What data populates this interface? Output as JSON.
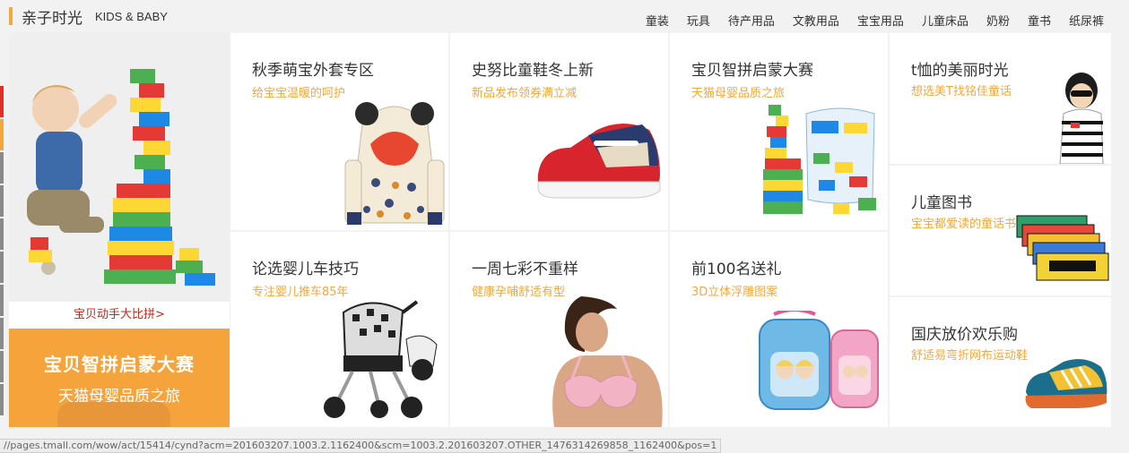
{
  "header": {
    "title": "亲子时光",
    "subtitle": "KIDS & BABY",
    "nav": [
      "童装",
      "玩具",
      "待产用品",
      "文教用品",
      "宝宝用品",
      "儿童床品",
      "奶粉",
      "童书",
      "纸尿裤"
    ]
  },
  "banner": {
    "link_label": "宝贝动手大比拼>",
    "promo_title": "宝贝智拼启蒙大赛",
    "promo_subtitle": "天猫母婴品质之旅"
  },
  "tiles": [
    {
      "title": "秋季萌宝外套专区",
      "subtitle": "给宝宝温暖的呵护",
      "icon": "kids-jacket-image"
    },
    {
      "title": "史努比童鞋冬上新",
      "subtitle": "新品发布领券满立减",
      "icon": "kids-sneaker-image"
    },
    {
      "title": "宝贝智拼启蒙大赛",
      "subtitle": "天猫母婴品质之旅",
      "icon": "building-blocks-image"
    },
    {
      "title": "论选婴儿车技巧",
      "subtitle": "专注婴儿推车85年",
      "icon": "baby-stroller-image"
    },
    {
      "title": "一周七彩不重样",
      "subtitle": "健康孕哺舒适有型",
      "icon": "nursing-bra-image"
    },
    {
      "title": "前100名送礼",
      "subtitle": "3D立体浮雕图案",
      "icon": "school-backpack-image"
    }
  ],
  "side_tiles": [
    {
      "title": "t恤的美丽时光",
      "subtitle": "想选美T找铭佳童话",
      "icon": "girl-tshirt-image"
    },
    {
      "title": "儿童图书",
      "subtitle": "宝宝都爱读的童话书",
      "icon": "kids-books-image"
    },
    {
      "title": "国庆放价欢乐购",
      "subtitle": "舒适易弯折网布运动鞋",
      "icon": "sport-shoe-image"
    }
  ],
  "status_url": "//pages.tmall.com/wow/act/15414/cynd?acm=201603207.1003.2.1162400&scm=1003.2.201603207.OTHER_1476314269858_1162400&pos=1",
  "colors": {
    "accent": "#f2a83a",
    "promo_bg": "#f5a43b",
    "link_red": "#c4271e",
    "nav_strip_red": "#e0302a"
  }
}
